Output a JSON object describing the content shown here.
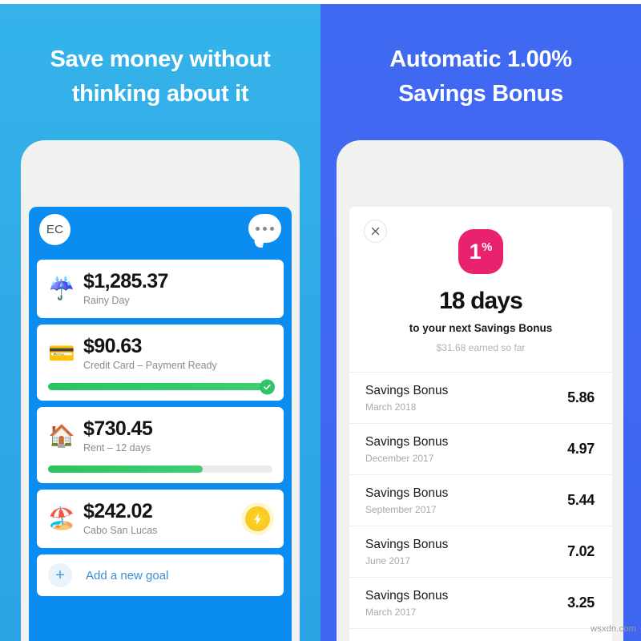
{
  "panels": {
    "left": {
      "headline_line1": "Save money without",
      "headline_line2": "thinking about it",
      "bg_color": "#2fa9e6"
    },
    "right": {
      "headline_line1": "Automatic 1.00%",
      "headline_line2": "Savings Bonus",
      "bg_color": "#4069f2"
    }
  },
  "left_app": {
    "avatar_initials": "EC",
    "menu_icon": "chat-bubble-ellipsis-icon",
    "goals": [
      {
        "emoji": "☔",
        "emoji_name": "umbrella-with-rain-icon",
        "amount": "$1,285.37",
        "label": "Rainy Day",
        "has_progress": false,
        "progress_pct": 0,
        "complete": false,
        "badge": null
      },
      {
        "emoji": "💳",
        "emoji_name": "credit-card-icon",
        "amount": "$90.63",
        "label": "Credit Card – Payment Ready",
        "has_progress": true,
        "progress_pct": 100,
        "complete": true,
        "badge": null
      },
      {
        "emoji": "🏠",
        "emoji_name": "house-icon",
        "amount": "$730.45",
        "label": "Rent – 12 days",
        "has_progress": true,
        "progress_pct": 69,
        "complete": false,
        "badge": null
      },
      {
        "emoji": "🏖️",
        "emoji_name": "beach-with-umbrella-icon",
        "amount": "$242.02",
        "label": "Cabo San Lucas",
        "has_progress": false,
        "progress_pct": 0,
        "complete": false,
        "badge": "lightning-bolt-icon"
      }
    ],
    "add_goal_label": "Add a new goal",
    "progress_color": "#2ec566",
    "screen_color": "#0a8cf0"
  },
  "right_app": {
    "close_icon": "close-x-icon",
    "badge_number": "1",
    "badge_symbol": "%",
    "badge_color": "#e8226c",
    "days_headline": "18 days",
    "days_subtitle": "to your next Savings Bonus",
    "earned_note": "$31.68 earned so far",
    "transactions": [
      {
        "title": "Savings Bonus",
        "date": "March 2018",
        "amount": "5.86"
      },
      {
        "title": "Savings Bonus",
        "date": "December 2017",
        "amount": "4.97"
      },
      {
        "title": "Savings Bonus",
        "date": "September 2017",
        "amount": "5.44"
      },
      {
        "title": "Savings Bonus",
        "date": "June 2017",
        "amount": "7.02"
      },
      {
        "title": "Savings Bonus",
        "date": "March 2017",
        "amount": "3.25"
      }
    ]
  },
  "watermark": "wsxdn.com"
}
